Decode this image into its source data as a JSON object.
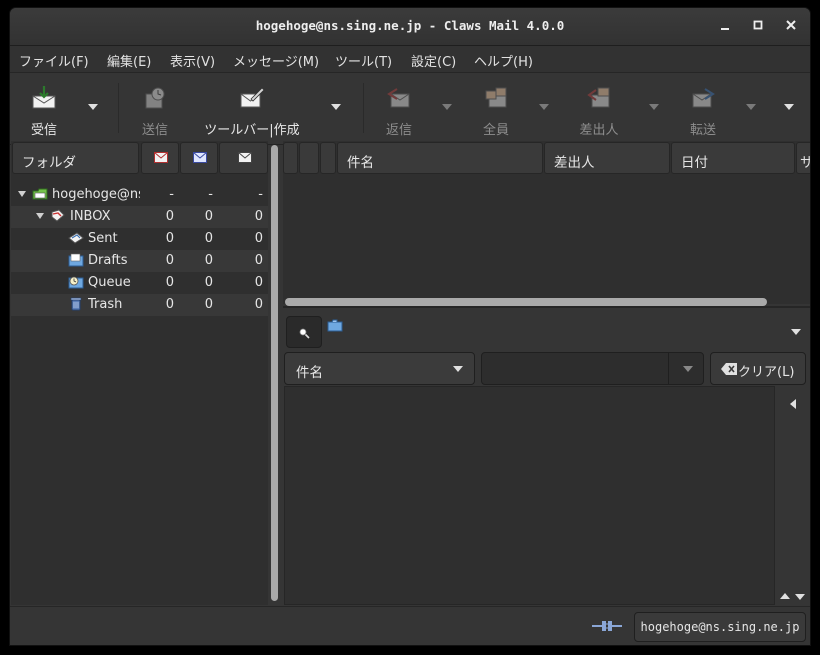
{
  "window": {
    "title": "hogehoge@ns.sing.ne.jp - Claws Mail 4.0.0",
    "minimize": "–",
    "maximize": "□",
    "close": "✕"
  },
  "menu": [
    "ファイル(F)",
    "編集(E)",
    "表示(V)",
    "メッセージ(M)",
    "ツール(T)",
    "設定(C)",
    "ヘルプ(H)"
  ],
  "toolbar": {
    "receive": "受信",
    "send": "送信",
    "compose": "ツールバー|作成",
    "reply": "返信",
    "reply_all": "全員",
    "reply_sender": "差出人",
    "forward": "転送"
  },
  "folder_header": {
    "folder": "フォルダ",
    "new_icon": "new-mail-icon",
    "unread_icon": "unread-mail-icon",
    "total_icon": "total-mail-icon"
  },
  "folders": [
    {
      "name": "hogehoge@ns",
      "new": "-",
      "unread": "-",
      "total": "-",
      "icon": "mailbox-icon"
    },
    {
      "name": "INBOX",
      "new": "0",
      "unread": "0",
      "total": "0",
      "icon": "inbox-icon"
    },
    {
      "name": "Sent",
      "new": "0",
      "unread": "0",
      "total": "0",
      "icon": "sent-icon"
    },
    {
      "name": "Drafts",
      "new": "0",
      "unread": "0",
      "total": "0",
      "icon": "drafts-icon"
    },
    {
      "name": "Queue",
      "new": "0",
      "unread": "0",
      "total": "0",
      "icon": "queue-icon"
    },
    {
      "name": "Trash",
      "new": "0",
      "unread": "0",
      "total": "0",
      "icon": "trash-icon"
    }
  ],
  "message_columns": {
    "subject": "件名",
    "from": "差出人",
    "date": "日付",
    "size": "サ"
  },
  "quicksearch": {
    "type": "件名",
    "value": "",
    "clear": "クリア(L)"
  },
  "status": {
    "account": "hogehoge@ns.sing.ne.jp"
  }
}
